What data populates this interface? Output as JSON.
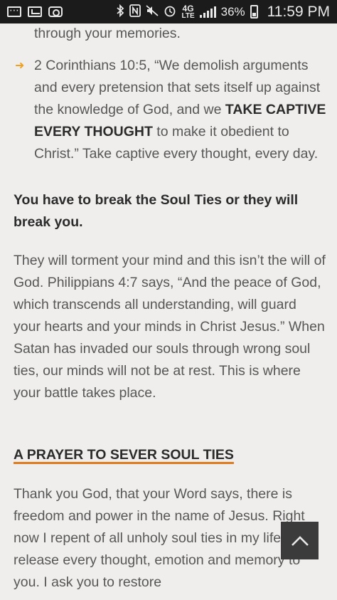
{
  "status_bar": {
    "battery_percent": "36%",
    "time": "11:59 PM",
    "network": "4G",
    "network_sub": "LTE",
    "icons": [
      "chat-icon",
      "gallery-icon",
      "instagram-icon",
      "bluetooth-icon",
      "nfc-icon",
      "mute-icon",
      "alarm-icon",
      "network-icon",
      "signal-icon",
      "battery-icon"
    ]
  },
  "article": {
    "fragment_top": "through your memories.",
    "bullet": {
      "text_before": "2 Corinthians 10:5, “We demolish arguments and every pretension that sets itself up against the knowledge of God, and we ",
      "emphasis": "TAKE CAPTIVE EVERY THOUGHT",
      "text_after": " to make it obedient to Christ.”  Take captive every thought, every day."
    },
    "heading": "You have to break the Soul Ties or they will break you.",
    "paragraph": "They will torment your mind and this isn’t the will of God.  Philippians 4:7 says, “And the peace of God, which transcends all understanding, will guard your hearts and your minds in Christ Jesus.”  When Satan has invaded our souls through wrong soul ties, our minds will not be at rest. This is where your battle takes place.",
    "prayer_heading": "A PRAYER TO SEVER SOUL TIES",
    "prayer_text": "Thank you God, that your Word says, there is freedom and power in the name of Jesus. Right now I repent of all unholy soul ties in my life.  I release every thought, emotion and memory to you. I ask you to restore"
  },
  "colors": {
    "status_bar_bg": "#1b1b1b",
    "page_bg": "#efeeec",
    "accent": "#f0a020",
    "underline": "#e07a1e",
    "scroll_button_bg": "#3b3b3b"
  }
}
